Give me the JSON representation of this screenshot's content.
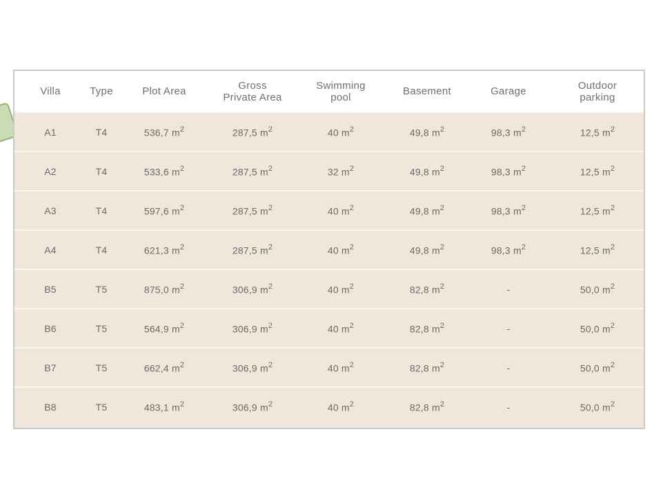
{
  "table": {
    "headers": [
      "Villa",
      "Type",
      "Plot Area",
      "Gross\nPrivate Area",
      "Swimming\npool",
      "Basement",
      "Garage",
      "Outdoor\nparking"
    ],
    "unit_superscript": "2",
    "rows": [
      {
        "villa": "A1",
        "type": "T4",
        "plot_area": "536,7 m",
        "gross_private_area": "287,5 m",
        "swimming_pool": "40 m",
        "basement": "49,8 m",
        "garage": "98,3 m",
        "outdoor_parking": "12,5 m"
      },
      {
        "villa": "A2",
        "type": "T4",
        "plot_area": "533,6 m",
        "gross_private_area": "287,5 m",
        "swimming_pool": "32 m",
        "basement": "49,8 m",
        "garage": "98,3 m",
        "outdoor_parking": "12,5 m"
      },
      {
        "villa": "A3",
        "type": "T4",
        "plot_area": "597,6 m",
        "gross_private_area": "287,5 m",
        "swimming_pool": "40 m",
        "basement": "49,8 m",
        "garage": "98,3 m",
        "outdoor_parking": "12,5 m"
      },
      {
        "villa": "A4",
        "type": "T4",
        "plot_area": "621,3 m",
        "gross_private_area": "287,5 m",
        "swimming_pool": "40 m",
        "basement": "49,8 m",
        "garage": "98,3 m",
        "outdoor_parking": "12,5 m"
      },
      {
        "villa": "B5",
        "type": "T5",
        "plot_area": "875,0 m",
        "gross_private_area": "306,9 m",
        "swimming_pool": "40 m",
        "basement": "82,8 m",
        "garage": "-",
        "outdoor_parking": "50,0 m"
      },
      {
        "villa": "B6",
        "type": "T5",
        "plot_area": "564,9 m",
        "gross_private_area": "306,9 m",
        "swimming_pool": "40 m",
        "basement": "82,8 m",
        "garage": "-",
        "outdoor_parking": "50,0 m"
      },
      {
        "villa": "B7",
        "type": "T5",
        "plot_area": "662,4 m",
        "gross_private_area": "306,9 m",
        "swimming_pool": "40 m",
        "basement": "82,8 m",
        "garage": "-",
        "outdoor_parking": "50,0 m"
      },
      {
        "villa": "B8",
        "type": "T5",
        "plot_area": "483,1 m",
        "gross_private_area": "306,9 m",
        "swimming_pool": "40 m",
        "basement": "82,8 m",
        "garage": "-",
        "outdoor_parking": "50,0 m"
      }
    ]
  },
  "colors": {
    "row_background": "#f1e6da",
    "header_background": "#ffffff",
    "text": "#6a6a6a",
    "border": "#c9c9c9"
  }
}
